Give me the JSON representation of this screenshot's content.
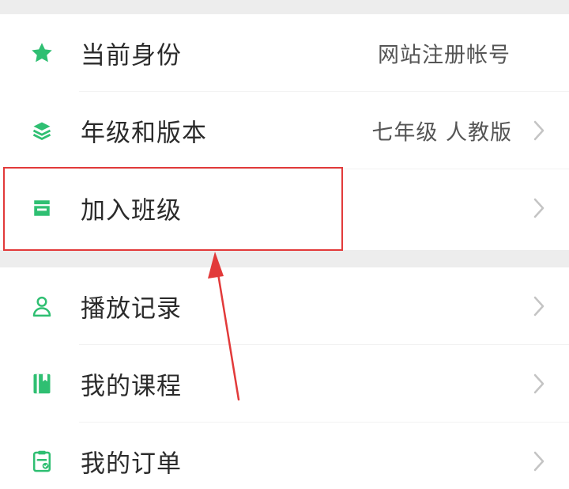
{
  "colors": {
    "icon_green": "#2fbf72",
    "highlight_red": "#e23a3a",
    "background": "#ededed",
    "card": "#ffffff",
    "text": "#2b2b2b",
    "value_text": "#555555",
    "chevron": "#c4c4c4"
  },
  "menu_group_1": [
    {
      "icon": "star-icon",
      "label": "当前身份",
      "value": "网站注册帐号",
      "has_chevron": false
    },
    {
      "icon": "layers-icon",
      "label": "年级和版本",
      "value": "七年级 人教版",
      "has_chevron": true
    },
    {
      "icon": "class-icon",
      "label": "加入班级",
      "value": "",
      "has_chevron": true
    }
  ],
  "menu_group_2": [
    {
      "icon": "user-icon",
      "label": "播放记录",
      "value": "",
      "has_chevron": true
    },
    {
      "icon": "book-icon",
      "label": "我的课程",
      "value": "",
      "has_chevron": true
    },
    {
      "icon": "order-icon",
      "label": "我的订单",
      "value": "",
      "has_chevron": true
    }
  ]
}
